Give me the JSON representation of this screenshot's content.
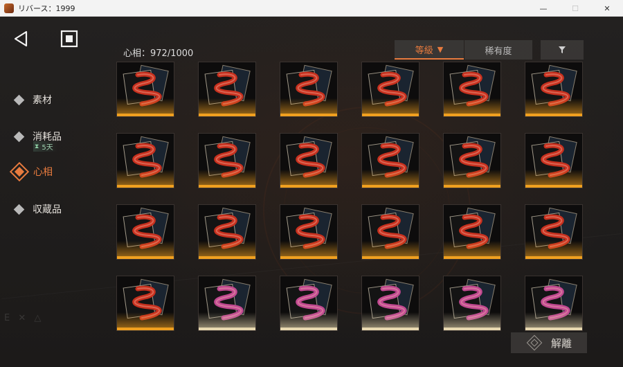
{
  "window": {
    "title": "リバース：1999",
    "minimize": "—",
    "maximize": "☐",
    "close": "✕"
  },
  "nav": {
    "back_icon": "back-triangle-icon",
    "home_icon": "home-square-icon"
  },
  "sidebar": {
    "items": [
      {
        "label": "素材",
        "active": false
      },
      {
        "label": "消耗品",
        "active": false,
        "timer": "5天"
      },
      {
        "label": "心相",
        "active": true
      },
      {
        "label": "収蔵品",
        "active": false
      }
    ]
  },
  "header": {
    "count": "心相：972/1000"
  },
  "sort": {
    "level_label": "等級",
    "level_caret": "▼",
    "rarity_label": "稀有度",
    "filter_icon": "filter-funnel-icon",
    "filter_glyph": "⯆"
  },
  "grid": {
    "rows": 4,
    "cols": 6,
    "cards": [
      {
        "art": "red-snake",
        "rarity": "gold"
      },
      {
        "art": "red-snake",
        "rarity": "gold"
      },
      {
        "art": "red-snake",
        "rarity": "gold"
      },
      {
        "art": "red-snake",
        "rarity": "gold"
      },
      {
        "art": "red-snake",
        "rarity": "gold"
      },
      {
        "art": "red-snake",
        "rarity": "gold"
      },
      {
        "art": "red-snake",
        "rarity": "gold"
      },
      {
        "art": "red-snake",
        "rarity": "gold"
      },
      {
        "art": "red-snake",
        "rarity": "gold"
      },
      {
        "art": "red-snake",
        "rarity": "gold"
      },
      {
        "art": "red-snake",
        "rarity": "gold"
      },
      {
        "art": "red-snake",
        "rarity": "gold"
      },
      {
        "art": "red-snake",
        "rarity": "gold"
      },
      {
        "art": "red-snake",
        "rarity": "gold"
      },
      {
        "art": "red-snake",
        "rarity": "gold"
      },
      {
        "art": "red-snake",
        "rarity": "gold"
      },
      {
        "art": "red-snake",
        "rarity": "gold"
      },
      {
        "art": "red-snake",
        "rarity": "gold"
      },
      {
        "art": "red-snake",
        "rarity": "gold"
      },
      {
        "art": "pink-snake",
        "rarity": "pale"
      },
      {
        "art": "pink-snake",
        "rarity": "pale"
      },
      {
        "art": "pink-snake",
        "rarity": "pale"
      },
      {
        "art": "pink-snake",
        "rarity": "pale"
      },
      {
        "art": "pink-snake",
        "rarity": "pale"
      }
    ]
  },
  "actions": {
    "dismantle_label": "解離"
  },
  "colors": {
    "accent": "#e87b3e",
    "gold_glow": "#f0a020",
    "pale_glow": "#e8d8b0",
    "red_snake": "#c7301e",
    "pink_snake": "#c04890"
  }
}
